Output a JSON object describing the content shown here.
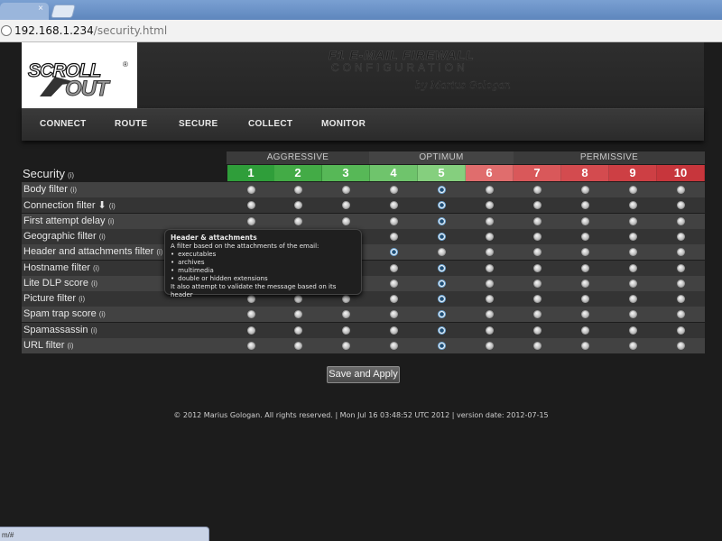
{
  "browser": {
    "tab_close_glyph": "×",
    "url_host": "192.168.1.234",
    "url_path": "/security.html"
  },
  "header": {
    "logo_line1": "SCROLL",
    "logo_line2": "OUT",
    "logo_reg": "®",
    "title_line1": "F1 E-MAIL FIREWALL",
    "title_line2": "CONFIGURATION",
    "signature": "by Marius Gologan"
  },
  "nav": {
    "items": [
      "CONNECT",
      "ROUTE",
      "SECURE",
      "COLLECT",
      "MONITOR"
    ]
  },
  "grid": {
    "groups": [
      "AGGRESSIVE",
      "OPTIMUM",
      "PERMISSIVE"
    ],
    "levels": [
      "1",
      "2",
      "3",
      "4",
      "5",
      "6",
      "7",
      "8",
      "9",
      "10"
    ],
    "level_colors": [
      "#2f9e3a",
      "#43ab46",
      "#57b857",
      "#6fc46c",
      "#85cf7e",
      "#e06d6d",
      "#d9585a",
      "#d34b4f",
      "#cd3f44",
      "#c7363c"
    ],
    "section_title": "Security",
    "info_glyph": "(i)",
    "rows": [
      {
        "label": "Body filter",
        "selected": 5,
        "arrow": ""
      },
      {
        "label": "Connection filter",
        "selected": 5,
        "arrow": "⬇"
      },
      {
        "label": "First attempt delay",
        "selected": 5,
        "arrow": ""
      },
      {
        "label": "Geographic filter",
        "selected": 5,
        "arrow": ""
      },
      {
        "label": "Header and attachments filter",
        "selected": 4,
        "arrow": ""
      },
      {
        "label": "Hostname filter",
        "selected": 5,
        "arrow": ""
      },
      {
        "label": "Lite DLP score",
        "selected": 5,
        "arrow": ""
      },
      {
        "label": "Picture filter",
        "selected": 5,
        "arrow": ""
      },
      {
        "label": "Spam trap score",
        "selected": 5,
        "arrow": ""
      },
      {
        "label": "Spamassassin",
        "selected": 5,
        "arrow": ""
      },
      {
        "label": "URL filter",
        "selected": 5,
        "arrow": ""
      }
    ]
  },
  "tooltip": {
    "title": "Header & attachments",
    "intro": "A filter based on the attachments of the email:",
    "items": [
      "executables",
      "archives",
      "multimedia",
      "double or hidden extensions"
    ],
    "outro": "It also attempt to validate the message based on its header"
  },
  "actions": {
    "apply_label": "Save and Apply"
  },
  "footer": {
    "text": "© 2012 Marius Gologan. All rights reserved. | Mon Jul 16 03:48:52 UTC 2012 | version date: 2012-07-15"
  },
  "statusbar": {
    "text": "m/#"
  }
}
